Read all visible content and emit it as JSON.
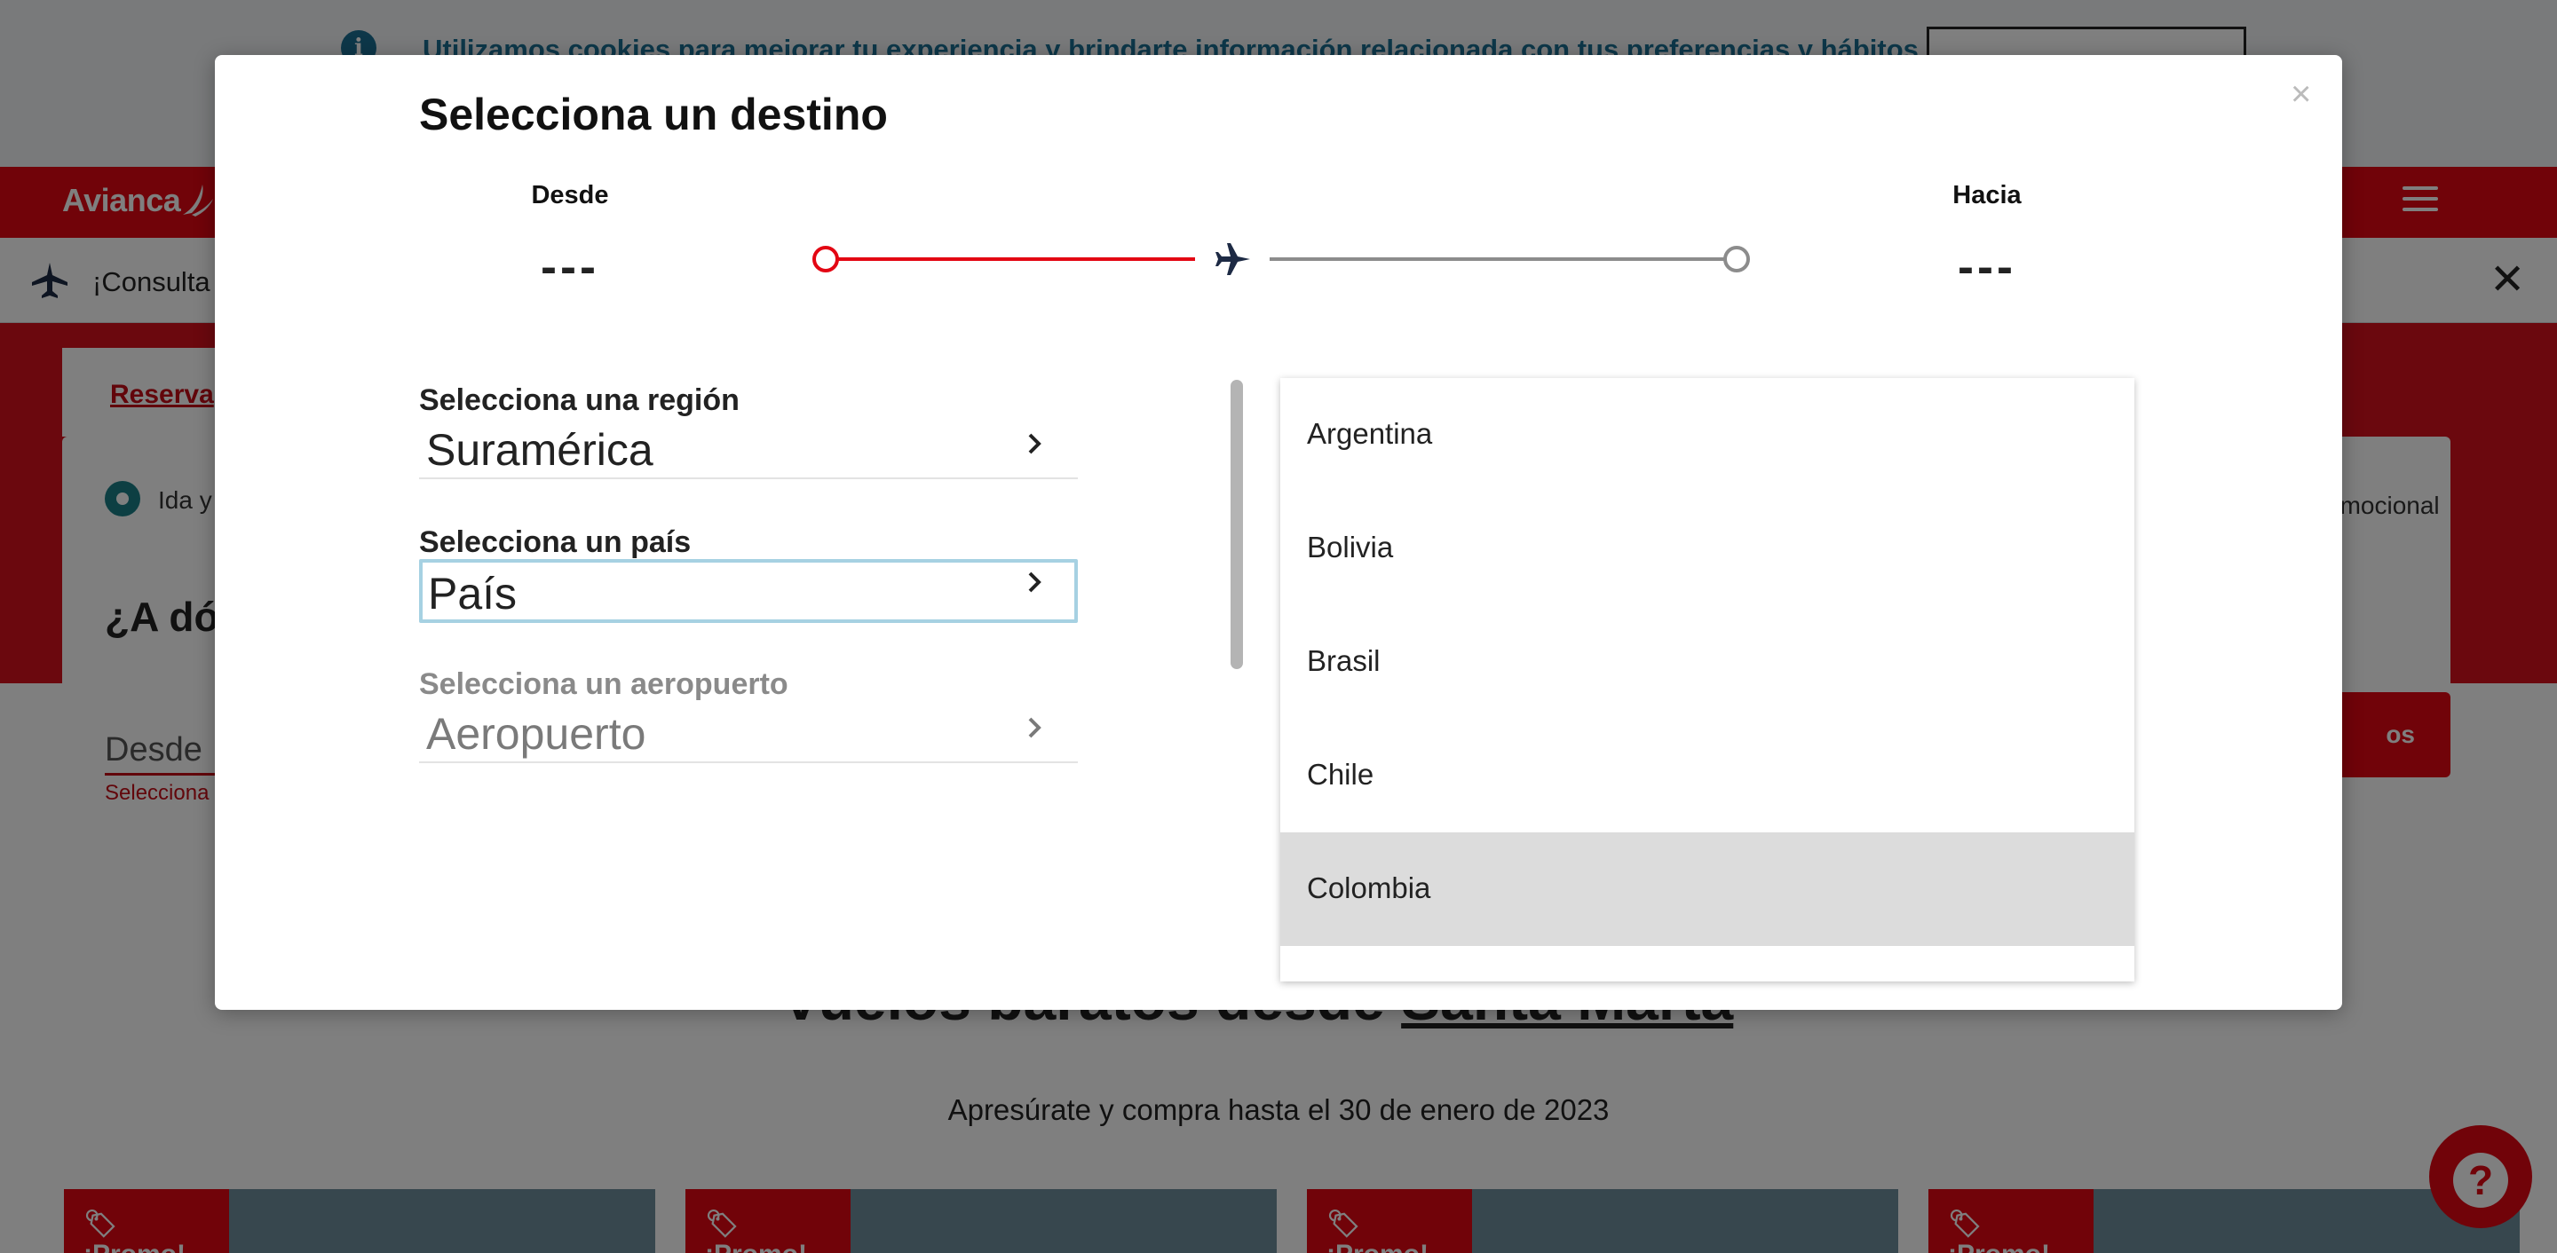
{
  "cookie": {
    "text": "Utilizamos cookies para mejorar tu experiencia y brindarte información relacionada con tus preferencias y hábitos"
  },
  "header": {
    "logo": "Avianca"
  },
  "alert": {
    "text": "¡Consulta"
  },
  "booking": {
    "tab_label": "Reserva",
    "trip_option": "Ida y",
    "promo_label": "omocional",
    "heading": "¿A dó",
    "origin_placeholder": "Desde",
    "origin_error": "Selecciona u",
    "search_label": "os"
  },
  "deals": {
    "title_prefix": "Vuelos baratos desde",
    "title_city": "Santa Marta",
    "subtitle": "Apresúrate y compra hasta el 30 de enero de 2023",
    "badge": "¡Promo!"
  },
  "modal": {
    "title": "Selecciona un destino",
    "close": "×",
    "route": {
      "from_label": "Desde",
      "from_code": "---",
      "to_label": "Hacia",
      "to_code": "---"
    },
    "fields": {
      "region_label": "Selecciona una región",
      "region_value": "Suramérica",
      "country_label": "Selecciona un país",
      "country_value": "País",
      "airport_label": "Selecciona un aeropuerto",
      "airport_value": "Aeropuerto"
    },
    "countries": [
      "Argentina",
      "Bolivia",
      "Brasil",
      "Chile",
      "Colombia"
    ],
    "highlighted_country": "Colombia"
  },
  "colors": {
    "brand_red": "#e30613",
    "focus_blue": "#a6d1e2",
    "cookie_blue": "#1b6f93"
  }
}
